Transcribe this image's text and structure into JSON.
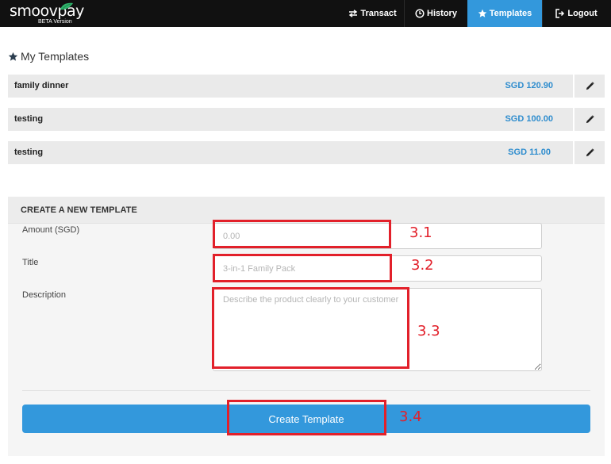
{
  "brand": {
    "logo_text": "smoovpay",
    "logo_main": "smoov",
    "logo_accent": "pay",
    "sub_label": "BETA Version"
  },
  "nav": {
    "transact": "Transact",
    "history": "History",
    "templates": "Templates",
    "logout": "Logout",
    "active": "templates"
  },
  "page": {
    "title": "My Templates"
  },
  "templates": [
    {
      "name": "family dinner",
      "amount": "SGD 120.90"
    },
    {
      "name": "testing",
      "amount": "SGD 100.00"
    },
    {
      "name": "testing",
      "amount": "SGD 11.00"
    }
  ],
  "create_form": {
    "header": "CREATE A NEW TEMPLATE",
    "amount_label": "Amount (SGD)",
    "amount_placeholder": "0.00",
    "amount_value": "",
    "title_label": "Title",
    "title_placeholder": "3-in-1 Family Pack",
    "title_value": "",
    "description_label": "Description",
    "description_placeholder": "Describe the product clearly to your customer",
    "description_value": "",
    "submit_label": "Create Template"
  },
  "annotations": [
    "3.1",
    "3.2",
    "3.3",
    "3.4"
  ],
  "colors": {
    "accent": "#3398dc",
    "amount_text": "#2f8dce",
    "navbar": "#111111",
    "annotation": "#e2202a"
  },
  "icons": {
    "transact": "transfer-arrows-icon",
    "history": "clock-icon",
    "templates": "star-icon",
    "logout": "logout-icon",
    "page_title": "star-icon",
    "edit": "pencil-icon"
  }
}
